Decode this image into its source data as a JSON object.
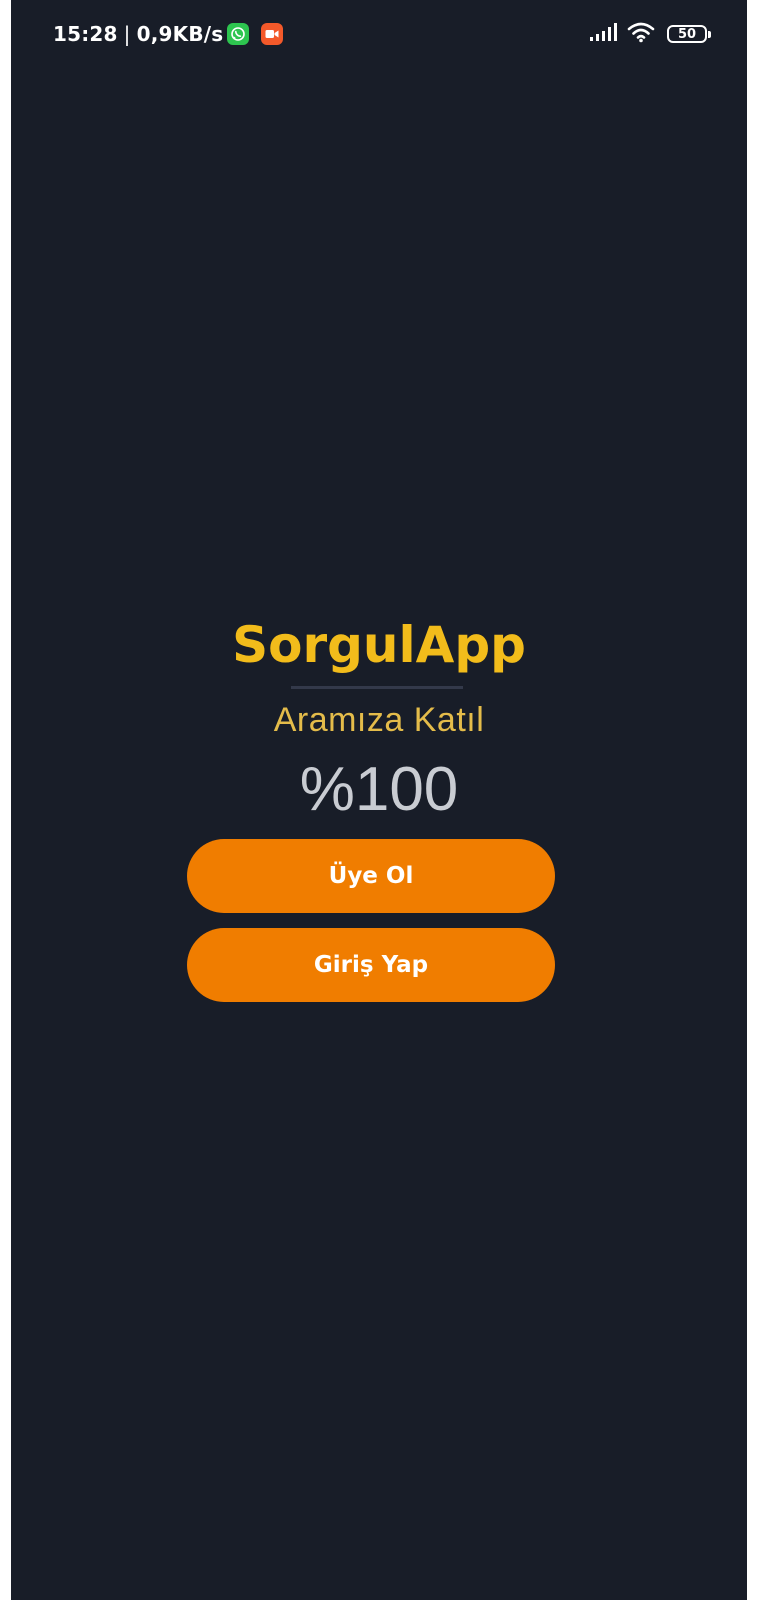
{
  "status_bar": {
    "time": "15:28",
    "separator": "|",
    "network_speed": "0,9KB/s",
    "notification_icons": [
      "whatsapp-icon",
      "screen-recorder-icon"
    ],
    "system_icons": [
      "signal-icon",
      "wifi-icon",
      "battery-icon"
    ],
    "battery_level": "50"
  },
  "app": {
    "title": "SorgulApp",
    "subtitle": "Aramıza Katıl",
    "progress_text": "%100"
  },
  "buttons": {
    "register_label": "Üye Ol",
    "login_label": "Giriş Yap"
  },
  "colors": {
    "background": "#181d28",
    "title": "#f2bc1b",
    "subtitle": "#e4bc4a",
    "button": "#f07d00",
    "button_text": "#ffffff"
  }
}
